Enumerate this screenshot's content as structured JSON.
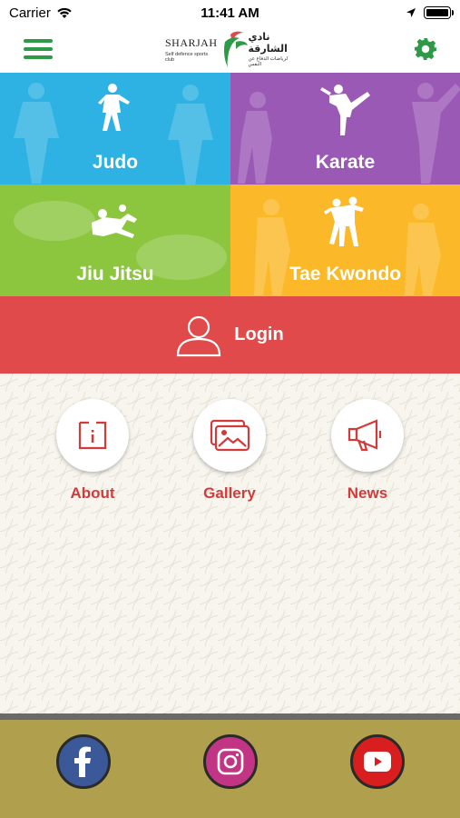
{
  "status_bar": {
    "carrier": "Carrier",
    "time": "11:41 AM"
  },
  "header": {
    "logo_en": "SHARJAH",
    "logo_en_sub": "Self defence sports club",
    "logo_ar": "نادي الشارقة",
    "logo_ar_sub": "لرياضات الدفاع عن النفس"
  },
  "tiles": [
    {
      "label": "Judo",
      "color": "#2eb2e4"
    },
    {
      "label": "Karate",
      "color": "#9b59b6"
    },
    {
      "label": "Jiu Jitsu",
      "color": "#8cc63f"
    },
    {
      "label": "Tae Kwondo",
      "color": "#fbb829"
    }
  ],
  "login": {
    "label": "Login",
    "color": "#e04a4a"
  },
  "info_items": [
    {
      "label": "About",
      "icon": "info-icon"
    },
    {
      "label": "Gallery",
      "icon": "gallery-icon"
    },
    {
      "label": "News",
      "icon": "megaphone-icon"
    }
  ],
  "social": [
    {
      "name": "facebook",
      "icon": "facebook-icon",
      "color": "#3b5998"
    },
    {
      "name": "instagram",
      "icon": "instagram-icon",
      "color": "#c13584"
    },
    {
      "name": "youtube",
      "icon": "youtube-icon",
      "color": "#d81e1e"
    }
  ],
  "colors": {
    "accent_green": "#2e9a47",
    "text_red": "#d33b3b",
    "footer": "#b09f4c"
  }
}
